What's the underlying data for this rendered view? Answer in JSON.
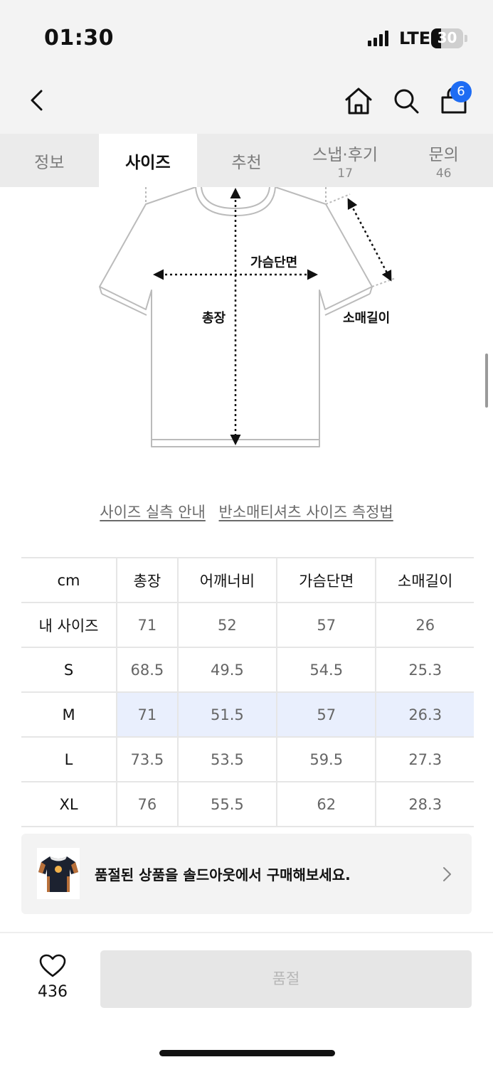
{
  "status_bar": {
    "time": "01:30",
    "network": "LTE",
    "battery": "30",
    "battery_level": 0.3
  },
  "nav": {
    "back_icon": "chevron-left-icon",
    "home_icon": "home-icon",
    "search_icon": "search-icon",
    "cart_icon": "shopping-bag-icon",
    "cart_count": "6",
    "badge_color": "#1e6cf3"
  },
  "tabs": [
    {
      "label": "정보",
      "count": "",
      "active": false
    },
    {
      "label": "사이즈",
      "count": "",
      "active": true
    },
    {
      "label": "추천",
      "count": "",
      "active": false
    },
    {
      "label": "스냅·후기",
      "count": "17",
      "active": false
    },
    {
      "label": "문의",
      "count": "46",
      "active": false
    }
  ],
  "diagram": {
    "chest_label": "가슴단면",
    "length_label": "총장",
    "sleeve_label": "소매길이"
  },
  "links": {
    "size_guide": "사이즈 실측 안내",
    "measure_guide": "반소매티셔츠 사이즈 측정법"
  },
  "size_table": {
    "headers": [
      "cm",
      "총장",
      "어깨너비",
      "가슴단면",
      "소매길이"
    ],
    "rows": [
      {
        "size": "내 사이즈",
        "values": [
          "71",
          "52",
          "57",
          "26"
        ]
      },
      {
        "size": "S",
        "values": [
          "68.5",
          "49.5",
          "54.5",
          "25.3"
        ]
      },
      {
        "size": "M",
        "values": [
          "71",
          "51.5",
          "57",
          "26.3"
        ],
        "highlighted": true
      },
      {
        "size": "L",
        "values": [
          "73.5",
          "53.5",
          "59.5",
          "27.3"
        ]
      },
      {
        "size": "XL",
        "values": [
          "76",
          "55.5",
          "62",
          "28.3"
        ]
      }
    ],
    "highlight_color": "#e9effd"
  },
  "soldout_banner": {
    "text": "품절된 상품을 솔드아웃에서 구매해보세요.",
    "chevron_icon": "chevron-right-icon"
  },
  "bottom_bar": {
    "like_icon": "heart-icon",
    "like_count": "436",
    "buy_label": "품절"
  }
}
